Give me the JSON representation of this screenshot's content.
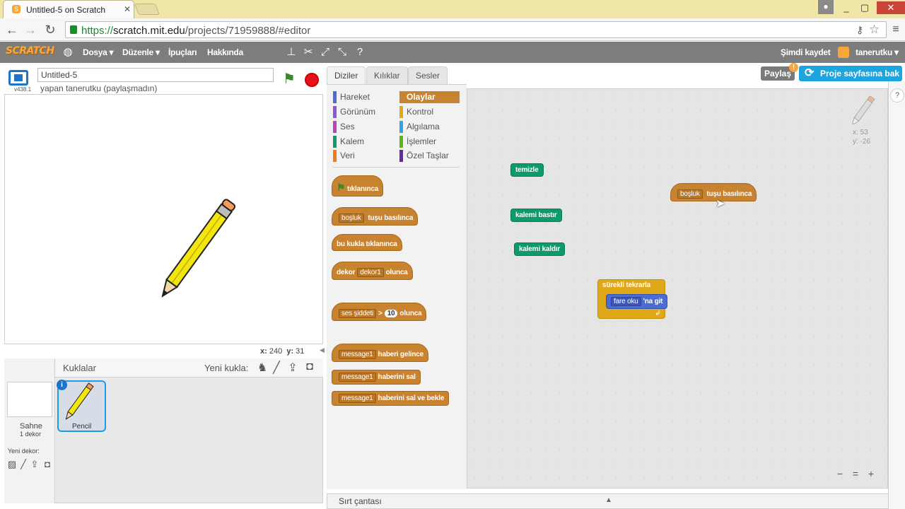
{
  "browser": {
    "tab_title": "Untitled-5 on Scratch",
    "favicon": "S",
    "url_scheme": "https://",
    "url_host": "scratch.mit.edu",
    "url_path": "/projects/71959888/#editor",
    "user_icon": "person-icon",
    "win_min": "_",
    "win_max": "▢",
    "win_close": "✕"
  },
  "menubar": {
    "logo": "SCRATCH",
    "items": [
      "Dosya ▾",
      "Düzenle ▾",
      "İpuçları",
      "Hakkında"
    ],
    "save_now": "Şimdi kaydet",
    "username": "tanerutku ▾"
  },
  "stage": {
    "project_title": "Untitled-5",
    "version": "v438.1",
    "author": "yapan tanerutku (paylaşmadın)",
    "x_label": "x:",
    "x_value": "240",
    "y_label": "y:",
    "y_value": "31"
  },
  "sprites": {
    "header": "Kuklalar",
    "new_sprite": "Yeni kukla:",
    "stage_label": "Sahne",
    "stage_backdrops": "1 dekor",
    "new_backdrop": "Yeni dekor:",
    "sprite_name": "Pencil",
    "info": "i"
  },
  "tabs": [
    "Diziler",
    "Kılıklar",
    "Sesler"
  ],
  "categories": {
    "left": [
      {
        "label": "Hareket",
        "color": "#4a6cd4"
      },
      {
        "label": "Görünüm",
        "color": "#8a55d7"
      },
      {
        "label": "Ses",
        "color": "#bb42c3"
      },
      {
        "label": "Kalem",
        "color": "#0e9a6c"
      },
      {
        "label": "Veri",
        "color": "#ee7d16"
      }
    ],
    "right": [
      {
        "label": "Olaylar",
        "color": "#c88330",
        "selected": true
      },
      {
        "label": "Kontrol",
        "color": "#e1a91a"
      },
      {
        "label": "Algılama",
        "color": "#2ca5e2"
      },
      {
        "label": "İşlemler",
        "color": "#5cb712"
      },
      {
        "label": "Özel Taşlar",
        "color": "#632d99"
      }
    ]
  },
  "palette_blocks": {
    "flag_clicked": "tıklanınca",
    "key_dropdown": "boşluk",
    "key_pressed": "tuşu basılınca",
    "sprite_clicked": "bu kukla tıklanınca",
    "backdrop_prefix": "dekor",
    "backdrop_dropdown": "dekor1",
    "backdrop_suffix": "olunca",
    "sensor_dropdown": "ses şiddeti",
    "gt": ">",
    "sensor_value": "10",
    "sensor_suffix": "olunca",
    "msg1": "message1",
    "receive": "haberi gelince",
    "msg2": "message1",
    "broadcast": "haberini sal",
    "msg3": "message1",
    "broadcast_wait": "haberini sal ve bekle"
  },
  "script_blocks": {
    "clear": "temizle",
    "pen_down": "kalemi bastır",
    "pen_up": "kalemi kaldır",
    "key_dropdown": "boşluk",
    "key_pressed": "tuşu basılınca",
    "forever": "sürekli tekrarla",
    "goto_dropdown": "fare oku",
    "goto_suffix": "'na git"
  },
  "share": {
    "share_button": "Paylaş",
    "badge": "!",
    "project_page": "Proje sayfasına bak"
  },
  "sprite_info": {
    "x": "x: 53",
    "y": "y: -26"
  },
  "zoom": {
    "out": "−",
    "reset": "=",
    "in": "+"
  },
  "backpack": "Sırt çantası",
  "help": "?"
}
